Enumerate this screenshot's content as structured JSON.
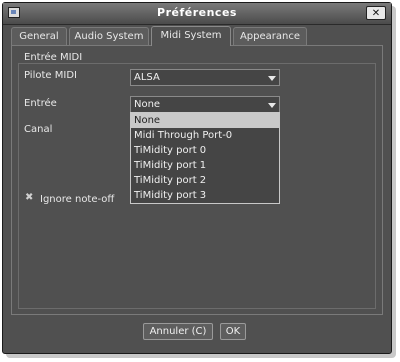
{
  "window": {
    "title": "Préférences",
    "close": "✕"
  },
  "tabs": [
    {
      "label": "General"
    },
    {
      "label": "Audio System"
    },
    {
      "label": "Midi System"
    },
    {
      "label": "Appearance"
    }
  ],
  "midi": {
    "group_title": "Entrée MIDI",
    "pilote_label": "Pilote MIDI",
    "pilote_value": "ALSA",
    "entree_label": "Entrée",
    "entree_value": "None",
    "canal_label": "Canal",
    "ignore_label": "Ignore note-off",
    "ignore_checked": true,
    "options": [
      "None",
      "Midi Through Port-0",
      "TiMidity port 0",
      "TiMidity port 1",
      "TiMidity port 2",
      "TiMidity port 3"
    ]
  },
  "buttons": {
    "cancel": "Annuler (C)",
    "ok": "OK"
  },
  "colors": {
    "background": "#505050",
    "title_gradient_top": "#7a7a7a",
    "selection": "#c9c9c9"
  }
}
